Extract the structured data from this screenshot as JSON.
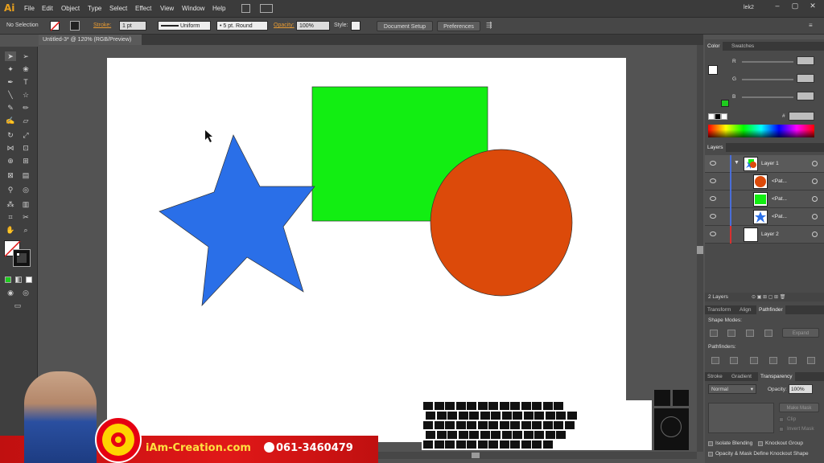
{
  "app": {
    "logo": "Ai"
  },
  "menu": [
    "File",
    "Edit",
    "Object",
    "Type",
    "Select",
    "Effect",
    "View",
    "Window",
    "Help"
  ],
  "user": "lek2",
  "control_bar": {
    "selection": "No Selection",
    "stroke_label": "Stroke:",
    "stroke_value": "1 pt",
    "profile": "Uniform",
    "brush": "5 pt. Round",
    "opacity_label": "Opacity:",
    "opacity_value": "100%",
    "style_label": "Style:",
    "doc_setup": "Document Setup",
    "preferences": "Preferences"
  },
  "document_tab": "Untitled-3* @ 120% (RGB/Preview)",
  "shapes": {
    "rectangle_color": "#12ee12",
    "star_color": "#2a6fe8",
    "circle_color": "#dc4a0a"
  },
  "color_panel": {
    "tabs": [
      "Color",
      "Swatches"
    ],
    "channels": [
      "R",
      "G",
      "B"
    ],
    "hex_label": "#"
  },
  "layers_panel": {
    "tab": "Layers",
    "rows": [
      {
        "name": "Layer 1"
      },
      {
        "name": "<Pat..."
      },
      {
        "name": "<Pat..."
      },
      {
        "name": "<Pat..."
      },
      {
        "name": "Layer 2"
      }
    ],
    "count": "2 Layers"
  },
  "pathfinder_panel": {
    "tabs": [
      "Transform",
      "Align",
      "Pathfinder"
    ],
    "shape_modes": "Shape Modes:",
    "pathfinders": "Pathfinders:",
    "expand": "Expand"
  },
  "transparency_panel": {
    "tabs": [
      "Stroke",
      "Gradient",
      "Transparency"
    ],
    "blend_mode": "Normal",
    "opacity_label": "Opacity:",
    "opacity_value": "100%",
    "make_mask": "Make Mask",
    "clip": "Clip",
    "invert_mask": "Invert Mask",
    "isolate": "Isolate Blending",
    "knockout": "Knockout Group",
    "opacity_mask": "Opacity & Mask Define Knockout Shape"
  },
  "banner": {
    "url": "iAm-Creation.com",
    "phone": "061-3460479"
  }
}
